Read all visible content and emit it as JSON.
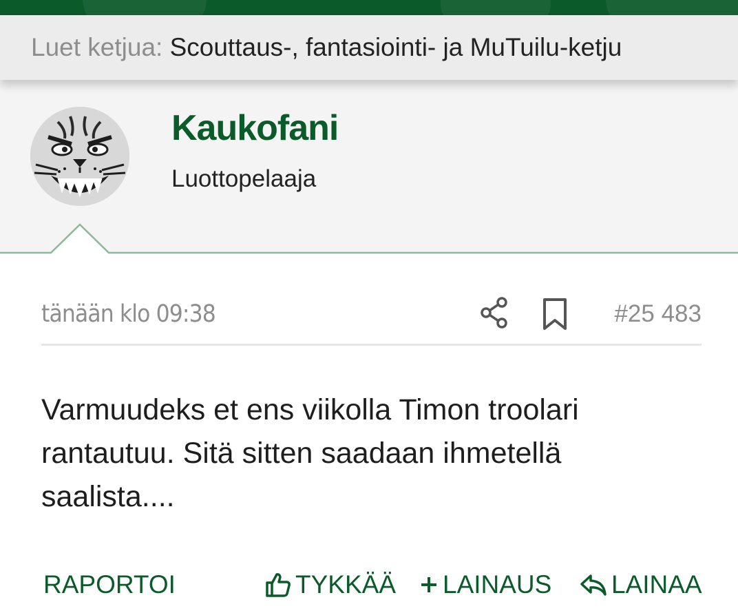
{
  "colors": {
    "brand_green": "#0b5a2a",
    "muted_text": "#8d8d8d",
    "body_text": "#1e1e1e",
    "user_block_bg": "#f4f4f4",
    "divider_green": "#8cb89a"
  },
  "thread_bar": {
    "prefix": "Luet ketjua:",
    "title": "Scouttaus-, fantasiointi- ja MuTuilu-ketju"
  },
  "user": {
    "avatar_icon": "panther-face-avatar",
    "name": "Kaukofani",
    "title": "Luottopelaaja"
  },
  "post": {
    "date": "tänään klo 09:38",
    "share_icon": "share-icon",
    "bookmark_icon": "bookmark-icon",
    "number": "#25 483",
    "body": "Varmuudeks et ens viikolla Timon troolari rantautuu. Sitä sitten saadaan ihmetellä saalista...."
  },
  "actions": {
    "report": "RAPORTOI",
    "like": "TYKKÄÄ",
    "add_quote": "LAINAUS",
    "quote": "LAINAA"
  }
}
